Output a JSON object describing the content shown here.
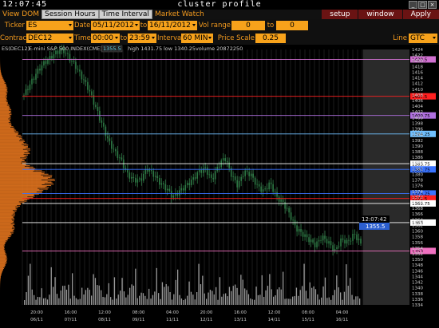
{
  "window": {
    "clock": "12:07:45",
    "title": "cluster profile"
  },
  "menu": {
    "tabs": [
      {
        "label": "View DOM",
        "active": false
      },
      {
        "label": "Session Hours",
        "active": true
      },
      {
        "label": "Time Interval",
        "active": true
      },
      {
        "label": "Market Watch",
        "active": false
      }
    ],
    "right": [
      "setup",
      "window",
      "Apply"
    ]
  },
  "params": {
    "ticker_label": "Ticker",
    "ticker": "ES",
    "date_label": "Date",
    "date_from": "05/11/2012",
    "date_to_label": "to",
    "date_to": "16/11/2012",
    "vol_range_label": "Vol range",
    "vol_from": "0",
    "vol_to_label": "to",
    "vol_to": "0",
    "contract_label": "Contract",
    "contract": "DEC12",
    "time_label": "Time",
    "time_from": "00:00",
    "time_to_label": "to",
    "time_to": "23:59",
    "interval_label": "Interval",
    "interval": "60 MIN",
    "price_scale_label": "Price Scale",
    "price_scale": "0.25",
    "line_label": "Line",
    "line": "GTC"
  },
  "chart_info": {
    "symbol": "ES(DEC12)",
    "instrument": "E-mini S&P 500 INDEX(CME)",
    "last": "1355.5",
    "high": "high 1431.75",
    "low": "low 1340.25",
    "volume": "volume 20872250",
    "cursor_time": "12:07:42",
    "cursor_price": "1355.5"
  },
  "colors": {
    "accent": "#f7a21b",
    "profile": "#e8771e",
    "candle": "#2e7a45",
    "volume": "#9a9a9a",
    "cursor": "#3a73d9"
  },
  "chart_data": {
    "type": "candlestick",
    "price_range": [
      1334,
      1424
    ],
    "price_ticks": [
      "1424",
      "1422",
      "1420",
      "1418",
      "1416",
      "1414",
      "1412",
      "1410",
      "1408",
      "1406",
      "1404",
      "1402",
      "1400",
      "1398",
      "1396",
      "1394",
      "1392",
      "1390",
      "1388",
      "1386",
      "1384",
      "1382",
      "1380",
      "1378",
      "1376",
      "1374",
      "1372",
      "1370",
      "1368",
      "1366",
      "1364",
      "1362",
      "1360",
      "1358",
      "1356",
      "1354",
      "1352",
      "1350",
      "1348",
      "1346",
      "1344",
      "1342",
      "1340",
      "1338",
      "1336",
      "1334"
    ],
    "levels": [
      {
        "price": 1420.5,
        "color": "#d070d0",
        "label": "1420.5"
      },
      {
        "price": 1407.5,
        "color": "#ff2020",
        "label": "1407.5"
      },
      {
        "price": 1400.75,
        "color": "#b070e0",
        "label": "1400.75"
      },
      {
        "price": 1394.25,
        "color": "#70c0ff",
        "label": "1394.25"
      },
      {
        "price": 1383.75,
        "color": "#ffffff",
        "label": "1383.75"
      },
      {
        "price": 1381.75,
        "color": "#3a73ff",
        "label": "1381.75"
      },
      {
        "price": 1373.25,
        "color": "#3a73ff",
        "label": "1373.25"
      },
      {
        "price": 1371.5,
        "color": "#ff2020",
        "label": "1371.5"
      },
      {
        "price": 1369.75,
        "color": "#ffffff",
        "label": "1369.75"
      },
      {
        "price": 1363.0,
        "color": "#ffffff",
        "label": "1363"
      },
      {
        "price": 1353.0,
        "color": "#f070c0",
        "label": "1353"
      }
    ],
    "x_labels": [
      {
        "time": "20:00",
        "date": "06/11"
      },
      {
        "time": "16:00",
        "date": "07/11"
      },
      {
        "time": "12:00",
        "date": "08/11"
      },
      {
        "time": "08:00",
        "date": "09/11"
      },
      {
        "time": "04:00",
        "date": "11/11"
      },
      {
        "time": "20:00",
        "date": "12/11"
      },
      {
        "time": "16:00",
        "date": "13/11"
      },
      {
        "time": "12:00",
        "date": "14/11"
      },
      {
        "time": "08:00",
        "date": "15/11"
      },
      {
        "time": "04:00",
        "date": "16/11"
      }
    ],
    "close_path": [
      1408,
      1412,
      1416,
      1419,
      1421,
      1423,
      1424,
      1421,
      1418,
      1414,
      1410,
      1404,
      1398,
      1392,
      1388,
      1385,
      1380,
      1378,
      1378,
      1382,
      1380,
      1377,
      1375,
      1372,
      1374,
      1376,
      1378,
      1381,
      1382,
      1378,
      1383,
      1386,
      1380,
      1376,
      1381,
      1380,
      1376,
      1374,
      1377,
      1372,
      1370,
      1366,
      1361,
      1359,
      1357,
      1355,
      1358,
      1356,
      1353,
      1357,
      1356,
      1359,
      1355.5
    ]
  }
}
